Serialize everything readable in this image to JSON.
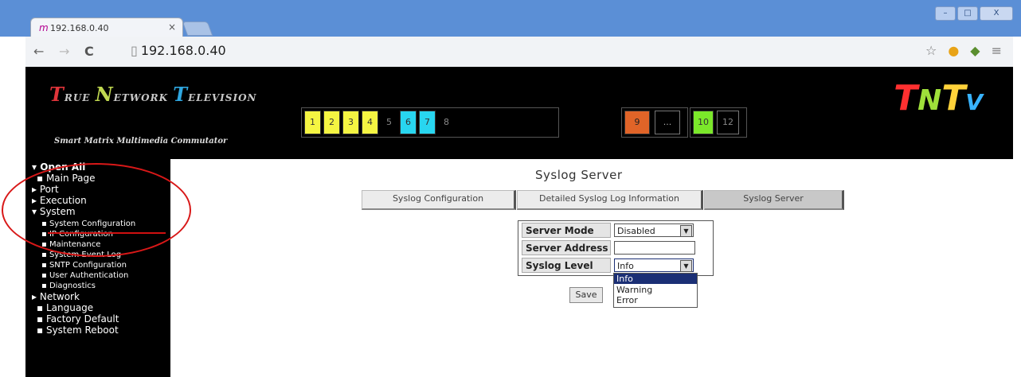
{
  "browser": {
    "tab_title": "192.168.0.40",
    "tab_favicon": "m",
    "tab_close": "×",
    "url": "192.168.0.40",
    "window_buttons": [
      "–",
      "□",
      "X"
    ]
  },
  "header": {
    "logo_words": [
      {
        "initial": "T",
        "rest": "RUE"
      },
      {
        "initial": "N",
        "rest": "ETWORK"
      },
      {
        "initial": "T",
        "rest": "ELEVISION"
      }
    ],
    "subtitle": "Smart Matrix Multimedia Commutator",
    "ports": [
      {
        "label": "1",
        "color": "#f5f542"
      },
      {
        "label": "2",
        "color": "#f5f542"
      },
      {
        "label": "3",
        "color": "#f5f542"
      },
      {
        "label": "4",
        "color": "#f5f542"
      },
      {
        "label": "5",
        "color": "#000000"
      },
      {
        "label": "6",
        "color": "#28d6f0"
      },
      {
        "label": "7",
        "color": "#28d6f0"
      },
      {
        "label": "8",
        "color": "#000000"
      },
      {
        "label": "9",
        "color": "#e06428"
      },
      {
        "label": "...",
        "color": "#000000"
      },
      {
        "label": "10",
        "color": "#7be82a"
      },
      {
        "label": "12",
        "color": "#000000"
      }
    ],
    "brand": {
      "t1": "T",
      "n": "N",
      "t2": "T",
      "v": "V"
    }
  },
  "sidebar": {
    "items": [
      {
        "label": "▾ Open All"
      },
      {
        "label": "▪ Main Page"
      },
      {
        "label": "▸ Port"
      },
      {
        "label": "▸ Execution"
      },
      {
        "label": "▾ System"
      },
      {
        "label": "▪ System Configuration"
      },
      {
        "label": "▪ IP Configuration"
      },
      {
        "label": "▪ Maintenance"
      },
      {
        "label": "▪ System Event Log"
      },
      {
        "label": "▪ SNTP Configuration"
      },
      {
        "label": "▪ User Authentication"
      },
      {
        "label": "▪ Diagnostics"
      },
      {
        "label": "▸ Network"
      },
      {
        "label": "▪ Language"
      },
      {
        "label": "▪ Factory Default"
      },
      {
        "label": "▪ System Reboot"
      }
    ]
  },
  "main": {
    "title": "Syslog Server",
    "tabs": [
      {
        "label": "Syslog Configuration"
      },
      {
        "label": "Detailed Syslog Log Information"
      },
      {
        "label": "Syslog Server"
      }
    ],
    "form": {
      "server_mode": {
        "label": "Server Mode",
        "value": "Disabled"
      },
      "server_address": {
        "label": "Server Address",
        "value": ""
      },
      "syslog_level": {
        "label": "Syslog Level",
        "value": "Info"
      }
    },
    "level_options": [
      "Info",
      "Warning",
      "Error"
    ],
    "save_label": "Save"
  }
}
